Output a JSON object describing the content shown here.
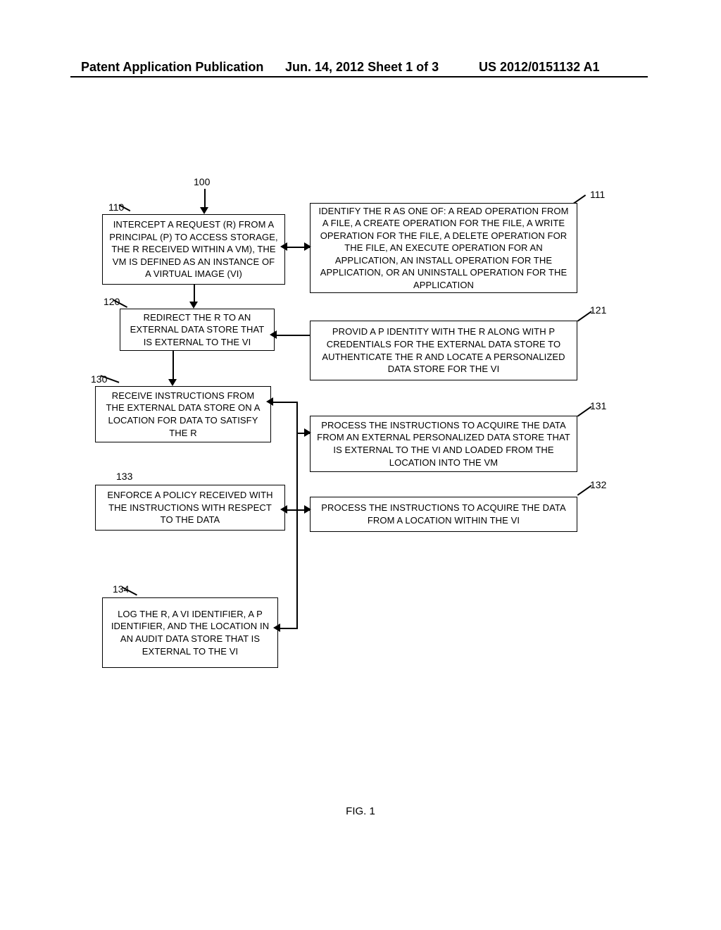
{
  "header": {
    "left": "Patent Application Publication",
    "center": "Jun. 14, 2012  Sheet 1 of 3",
    "right": "US 2012/0151132 A1"
  },
  "labels": {
    "main": "100",
    "n110": "110",
    "n111": "111",
    "n120": "120",
    "n121": "121",
    "n130": "130",
    "n131": "131",
    "n132": "132",
    "n133": "133",
    "n134": "134"
  },
  "boxes": {
    "b110": "INTERCEPT A REQUEST (R) FROM A PRINCIPAL (P) TO ACCESS STORAGE, THE R RECEIVED WITHIN A VM), THE VM IS DEFINED AS AN INSTANCE OF A VIRTUAL IMAGE (VI)",
    "b111": "IDENTIFY THE R AS ONE OF: A READ OPERATION FROM A FILE, A CREATE OPERATION FOR THE FILE, A WRITE OPERATION FOR THE FILE, A DELETE OPERATION FOR THE FILE, AN EXECUTE OPERATION FOR AN APPLICATION, AN INSTALL OPERATION FOR THE APPLICATION, OR AN UNINSTALL OPERATION FOR THE APPLICATION",
    "b120": "REDIRECT THE R TO AN EXTERNAL DATA STORE THAT IS EXTERNAL TO THE VI",
    "b121": "PROVID A P IDENTITY WITH THE R ALONG WITH P CREDENTIALS FOR THE EXTERNAL DATA STORE TO AUTHENTICATE THE R AND LOCATE A PERSONALIZED DATA STORE FOR THE VI",
    "b130": "RECEIVE INSTRUCTIONS FROM THE EXTERNAL DATA STORE ON A LOCATION FOR DATA TO SATISFY THE R",
    "b131": "PROCESS THE INSTRUCTIONS TO ACQUIRE THE DATA FROM AN EXTERNAL PERSONALIZED DATA STORE THAT IS EXTERNAL TO THE VI AND LOADED FROM THE LOCATION INTO THE VM",
    "b132": "PROCESS THE INSTRUCTIONS TO ACQUIRE THE DATA FROM A LOCATION WITHIN THE VI",
    "b133": "ENFORCE A POLICY RECEIVED WITH THE INSTRUCTIONS WITH RESPECT TO THE DATA",
    "b134": "LOG THE R, A VI IDENTIFIER, A P IDENTIFIER, AND THE LOCATION IN AN AUDIT DATA STORE THAT IS EXTERNAL TO THE VI"
  },
  "figure_caption": "FIG. 1"
}
